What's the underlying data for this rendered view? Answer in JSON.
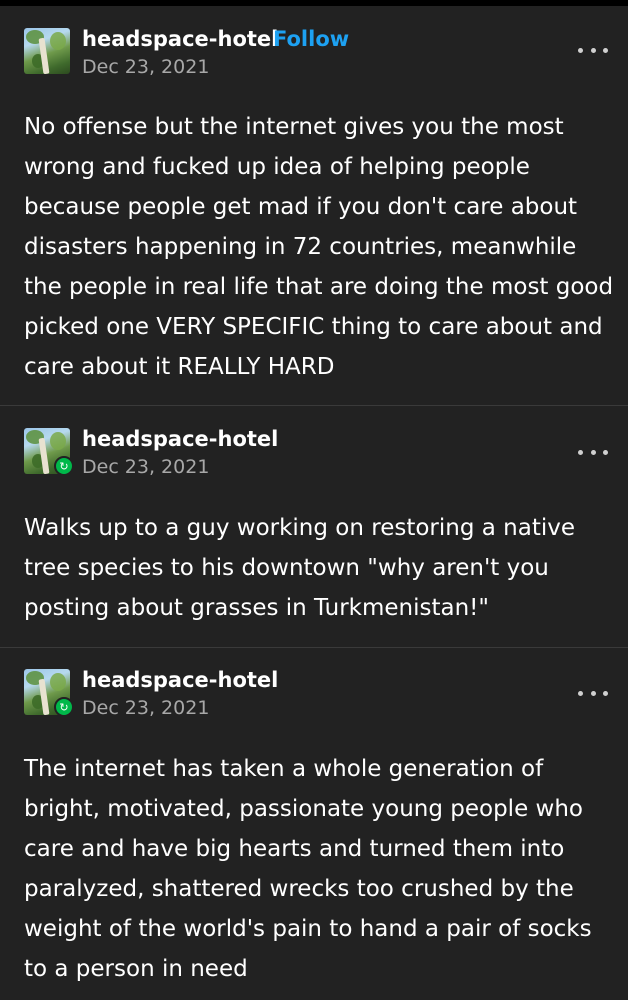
{
  "posts": [
    {
      "username": "headspace-hotel",
      "follow_label": "Follow",
      "date": "Dec 23, 2021",
      "text": "No offense but the internet gives you the most wrong and fucked up idea of helping people because people get mad if you don't care about disasters happening in 72 countries, meanwhile the people in real life that are doing the most good picked one VERY SPECIFIC thing to care about and care about it REALLY HARD",
      "icons": [
        "avatar",
        "more-icon"
      ]
    },
    {
      "username": "headspace-hotel",
      "date": "Dec 23, 2021",
      "text": "Walks up to a guy working on restoring a native tree species to his downtown \"why aren't you posting about grasses in Turkmenistan!\"",
      "icons": [
        "avatar",
        "reblog-icon",
        "more-icon"
      ]
    },
    {
      "username": "headspace-hotel",
      "date": "Dec 23, 2021",
      "text": "The internet has taken a whole generation of bright, motivated, passionate young people who care and have big hearts and turned them into paralyzed, shattered wrecks too crushed by the weight of the world's pain to hand a pair of socks to a person in need",
      "icons": [
        "avatar",
        "reblog-icon",
        "more-icon"
      ]
    }
  ],
  "colors": {
    "background": "#222222",
    "text": "#ffffff",
    "follow": "#1da1f2",
    "date": "#a8a8a8",
    "reblog_badge": "#00b84a"
  }
}
